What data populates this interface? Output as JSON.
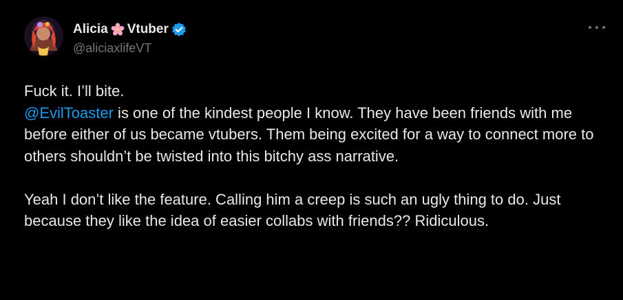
{
  "author": {
    "name": "Alicia",
    "name_emoji": "cherry-blossom",
    "name_suffix": "Vtuber",
    "handle": "@aliciaxlifeVT",
    "verified": true
  },
  "tweet": {
    "line1": "Fuck it. I’ll bite.",
    "mention": "@EvilToaster",
    "para1_rest": " is one of the kindest people I know. They have been friends with me before either of us became vtubers. Them being excited for a way to connect more to others shouldn’t be twisted into this bitchy ass narrative.",
    "para2": "Yeah I don’t like the feature. Calling him a creep is such an ugly thing to do. Just because they like the idea of easier collabs with friends?? Ridiculous."
  },
  "colors": {
    "background": "#000000",
    "text": "#e7e9ea",
    "muted": "#71767b",
    "accent": "#1d9bf0"
  },
  "icons": {
    "more": "more-horizontal-icon",
    "verified": "verified-badge-icon"
  }
}
